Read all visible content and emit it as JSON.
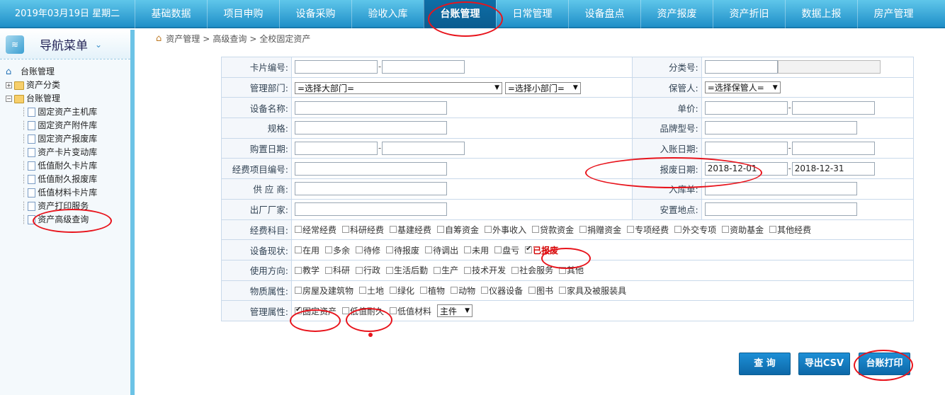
{
  "topbar": {
    "date": "2019年03月19日 星期二",
    "tabs": [
      "基础数据",
      "项目申购",
      "设备采购",
      "验收入库",
      "台账管理",
      "日常管理",
      "设备盘点",
      "资产报废",
      "资产折旧",
      "数据上报",
      "房产管理"
    ],
    "active_index": 4
  },
  "sidebar": {
    "title": "导航菜单",
    "tree": {
      "root": "台账管理",
      "group_collapsed": "资产分类",
      "group_expanded": "台账管理",
      "items": [
        "固定资产主机库",
        "固定资产附件库",
        "固定资产报废库",
        "资产卡片变动库",
        "低值耐久卡片库",
        "低值耐久报废库",
        "低值材料卡片库",
        "资产打印服务",
        "资产高级查询"
      ],
      "selected_index": 8
    }
  },
  "breadcrumb": {
    "p1": "资产管理",
    "sep1": ">",
    "p2": "高级查询",
    "sep2": ">",
    "p3": "全校固定资产"
  },
  "form": {
    "card_no": "卡片编号:",
    "category_no": "分类号:",
    "dept": "管理部门:",
    "dept_major": "=选择大部门=",
    "dept_minor": "=选择小部门=",
    "keeper": "保管人:",
    "keeper_sel": "=选择保管人=",
    "device_name": "设备名称:",
    "price": "单价:",
    "spec": "规格:",
    "brand": "品牌型号:",
    "purchase_date": "购置日期:",
    "entry_date": "入账日期:",
    "fund_no": "经费项目编号:",
    "scrap_date": "报废日期:",
    "scrap_from": "2018-12-01",
    "scrap_to": "2018-12-31",
    "supplier": "供 应 商:",
    "stock_in": "入库单:",
    "maker": "出厂厂家:",
    "location": "安置地点:",
    "fund_subject": "经费科目:",
    "fund_options": [
      "经常经费",
      "科研经费",
      "基建经费",
      "自筹资金",
      "外事收入",
      "贷款资金",
      "捐赠资金",
      "专项经费",
      "外交专项",
      "资助基金",
      "其他经费"
    ],
    "status": "设备现状:",
    "status_options": [
      "在用",
      "多余",
      "待修",
      "待报废",
      "待调出",
      "未用",
      "盘亏"
    ],
    "status_checked": "已报废",
    "use_dir": "使用方向:",
    "use_options": [
      "教学",
      "科研",
      "行政",
      "生活后勤",
      "生产",
      "技术开发",
      "社会服务",
      "其他"
    ],
    "material": "物质属性:",
    "material_options": [
      "房屋及建筑物",
      "土地",
      "绿化",
      "植物",
      "动物",
      "仪器设备",
      "图书",
      "家具及被服装具"
    ],
    "mgmt": "管理属性:",
    "mgmt_fixed": "固定资产",
    "mgmt_lowdur": "低值耐久",
    "mgmt_lowmat": "低值材料",
    "mgmt_sel": "主件"
  },
  "buttons": {
    "query": "查 询",
    "export": "导出CSV",
    "print": "台账打印"
  }
}
